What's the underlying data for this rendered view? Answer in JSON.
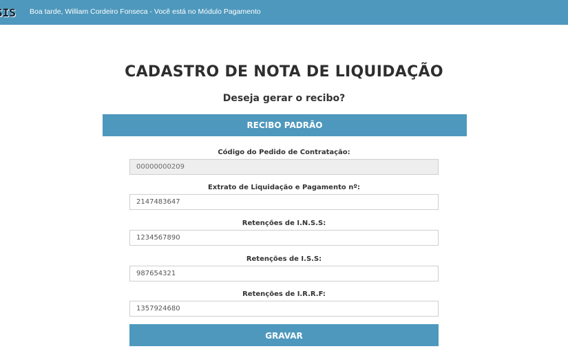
{
  "header": {
    "logo_text": "SIS",
    "greeting": "Boa tarde, William Cordeiro Fonseca - Você está no Módulo Pagamento"
  },
  "page": {
    "title": "CADASTRO DE NOTA DE LIQUIDAÇÃO",
    "subtitle": "Deseja gerar o recibo?",
    "section_label": "RECIBO PADRÃO"
  },
  "form": {
    "fields": [
      {
        "label": "Código do Pedido de Contratação:",
        "value": "00000000209",
        "readonly": true
      },
      {
        "label": "Extrato de Liquidação e Pagamento nº:",
        "value": "2147483647",
        "readonly": false
      },
      {
        "label": "Retenções de I.N.S.S:",
        "value": "1234567890",
        "readonly": false
      },
      {
        "label": "Retenções de I.S.S:",
        "value": "987654321",
        "readonly": false
      },
      {
        "label": "Retenções de I.R.R.F:",
        "value": "1357924680",
        "readonly": false
      }
    ],
    "submit_label": "GRAVAR"
  },
  "colors": {
    "accent": "#4e98bd",
    "readonly_bg": "#eeeeee"
  }
}
